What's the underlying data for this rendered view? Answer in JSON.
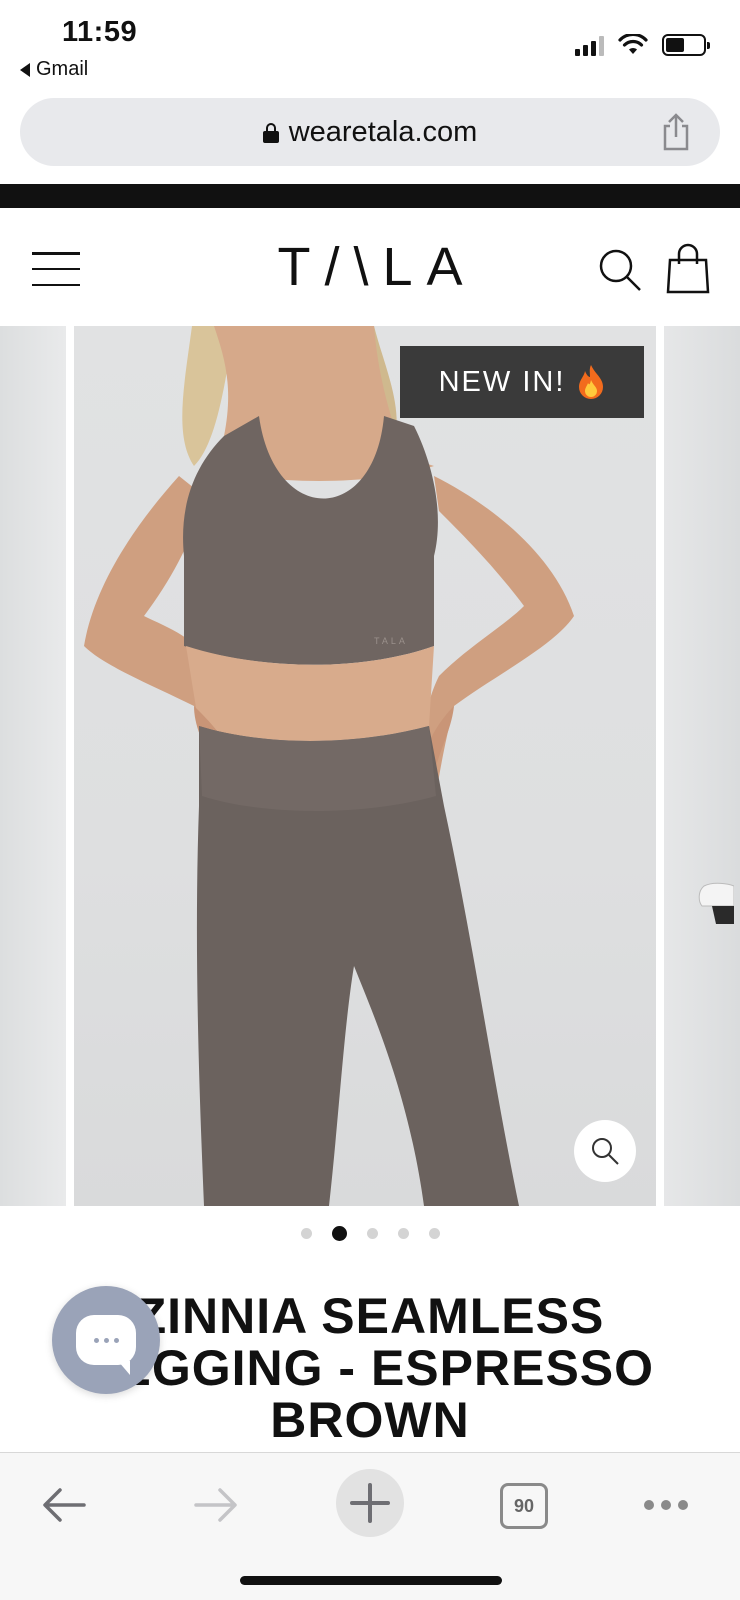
{
  "status_bar": {
    "time": "11:59",
    "back_app": "Gmail",
    "signal_icon": "cellular-signal-icon",
    "wifi_icon": "wifi-icon",
    "battery_icon": "battery-icon",
    "battery_level": 0.5
  },
  "browser": {
    "url": "wearetala.com",
    "lock_icon": "lock-icon",
    "share_icon": "share-icon"
  },
  "site_header": {
    "logo": "T/\\LA",
    "menu_icon": "hamburger-menu-icon",
    "search_icon": "search-icon",
    "bag_icon": "shopping-bag-icon"
  },
  "gallery": {
    "badge_text": "NEW IN!",
    "badge_icon": "fire-emoji-icon",
    "zoom_icon": "magnifier-icon",
    "dot_count": 5,
    "active_dot": 2
  },
  "product": {
    "title": "ZINNIA SEAMLESS LEGGING - ESPRESSO BROWN"
  },
  "chat": {
    "icon": "chat-bubble-icon"
  },
  "toolbar": {
    "back_icon": "back-arrow-icon",
    "forward_icon": "forward-arrow-icon",
    "new_tab_icon": "plus-icon",
    "tab_count": "90",
    "more_icon": "more-dots-icon"
  },
  "colors": {
    "badge_bg": "#3a3a3a",
    "chat_bg": "#9aa3b8",
    "url_bar_bg": "#e8e9ec",
    "fabric_brown": "#6f6561"
  }
}
